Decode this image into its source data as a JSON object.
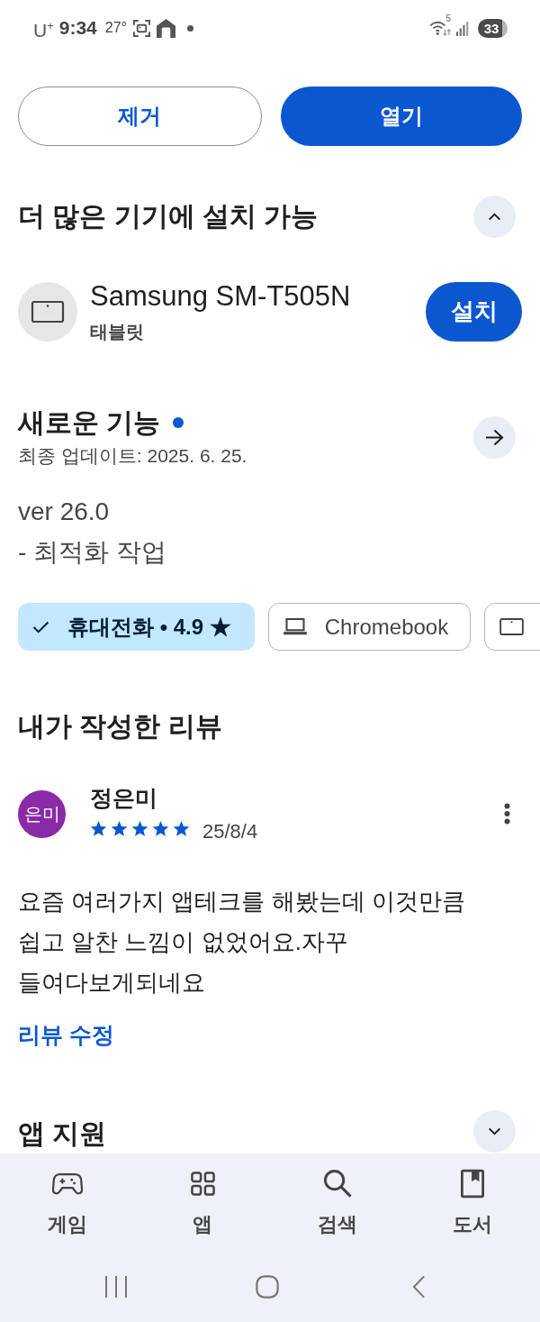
{
  "status_bar": {
    "carrier": "U$^{+}$",
    "time": "9:34",
    "temperature": "27°",
    "wifi_band": "5",
    "battery": "33"
  },
  "actions": [
    {
      "label": "제거",
      "kind": "outlined"
    },
    {
      "label": "열기",
      "kind": "filled"
    }
  ],
  "install_section": {
    "title": "더 많은 기기에 설치 가능",
    "expanded": true,
    "devices": [
      {
        "name": "Samsung SM-T505N",
        "type": "태블릿",
        "button": "설치"
      }
    ]
  },
  "whats_new": {
    "title": "새로운 기능",
    "unread": true,
    "updated": "최종 업데이트: 2025. 6. 25.",
    "notes": [
      "ver 26.0",
      "- 최적화 작업"
    ]
  },
  "device_chips": [
    {
      "label": "휴대전화 • 4.9 ★",
      "selected": true
    },
    {
      "kind": "laptop",
      "label": "Chromebook",
      "selected": false
    },
    {
      "kind": "tablet",
      "selected": false
    }
  ],
  "reviews_section": {
    "title": "내가 작성한 리뷰",
    "review": {
      "avatar": "은미",
      "author": "정은미",
      "stars": 5,
      "date": "25/8/4",
      "text": "요즘 여러가지 앱테크를 해봤는데 이것만큼 쉽고 알찬 느낌이 없었어요.자꾸 들여다보게되네요",
      "edit_link": "리뷰 수정"
    }
  },
  "support_section": {
    "title": "앱 지원",
    "expanded": false
  },
  "bottom_nav": [
    {
      "kind": "games",
      "label": "게임",
      "selected": false
    },
    {
      "kind": "apps",
      "label": "앱",
      "selected": false
    },
    {
      "kind": "search",
      "label": "검색",
      "selected": false
    },
    {
      "kind": "books",
      "label": "도서",
      "selected": false
    }
  ]
}
